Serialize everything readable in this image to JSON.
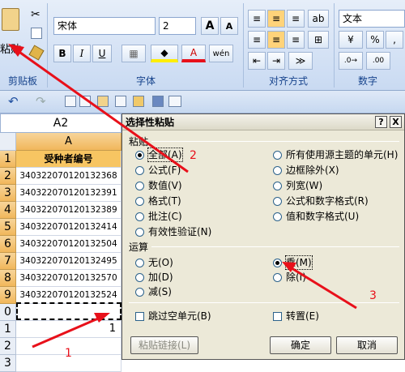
{
  "ribbon": {
    "paste_label": "粘贴",
    "clipboard_label": "剪贴板",
    "font_group_label": "字体",
    "align_group_label": "对齐方式",
    "number_group_label": "数字",
    "font_name": "宋体",
    "font_size": "2",
    "grow_font": "A",
    "shrink_font": "A",
    "bold": "B",
    "italic": "I",
    "underline": "U",
    "font_color_glyph": "A",
    "phonetic": "wén",
    "number_format": "文本",
    "percent": "%",
    "comma": ","
  },
  "sheet": {
    "name_box": "A2",
    "column_header": "A",
    "rows": [
      {
        "num": "1",
        "value": "受种者编号"
      },
      {
        "num": "2",
        "value": "340322070120132368"
      },
      {
        "num": "3",
        "value": "340322070120132391"
      },
      {
        "num": "4",
        "value": "340322070120132389"
      },
      {
        "num": "5",
        "value": "340322070120132414"
      },
      {
        "num": "6",
        "value": "340322070120132504"
      },
      {
        "num": "7",
        "value": "340322070120132495"
      },
      {
        "num": "8",
        "value": "340322070120132570"
      },
      {
        "num": "9",
        "value": "340322070120132524"
      },
      {
        "num": "0",
        "value": ""
      },
      {
        "num": "1",
        "value": "1"
      },
      {
        "num": "2",
        "value": ""
      },
      {
        "num": "3",
        "value": ""
      }
    ]
  },
  "dialog": {
    "title": "选择性粘贴",
    "help": "?",
    "close": "X",
    "paste_section": "粘贴",
    "paste_left": [
      {
        "label": "全部(A)",
        "checked": true
      },
      {
        "label": "公式(F)",
        "checked": false
      },
      {
        "label": "数值(V)",
        "checked": false
      },
      {
        "label": "格式(T)",
        "checked": false
      },
      {
        "label": "批注(C)",
        "checked": false
      },
      {
        "label": "有效性验证(N)",
        "checked": false
      }
    ],
    "paste_right": [
      {
        "label": "所有使用源主题的单元(H)",
        "checked": false
      },
      {
        "label": "边框除外(X)",
        "checked": false
      },
      {
        "label": "列宽(W)",
        "checked": false
      },
      {
        "label": "公式和数字格式(R)",
        "checked": false
      },
      {
        "label": "值和数字格式(U)",
        "checked": false
      }
    ],
    "op_section": "运算",
    "op_left": [
      {
        "label": "无(O)",
        "checked": false
      },
      {
        "label": "加(D)",
        "checked": false
      },
      {
        "label": "减(S)",
        "checked": false
      }
    ],
    "op_right": [
      {
        "label": "乘(M)",
        "checked": true
      },
      {
        "label": "除(I)",
        "checked": false
      }
    ],
    "skip_blanks": "跳过空单元(B)",
    "transpose": "转置(E)",
    "paste_link": "粘贴链接(L)",
    "ok": "确定",
    "cancel": "取消"
  },
  "annotations": {
    "one": "1",
    "two": "2",
    "three": "3"
  },
  "colors": {
    "arrow": "#e8101a",
    "row_header_selected": "#f1b75b",
    "ribbon": "#c9daf2",
    "dialog": "#ece9d8"
  }
}
